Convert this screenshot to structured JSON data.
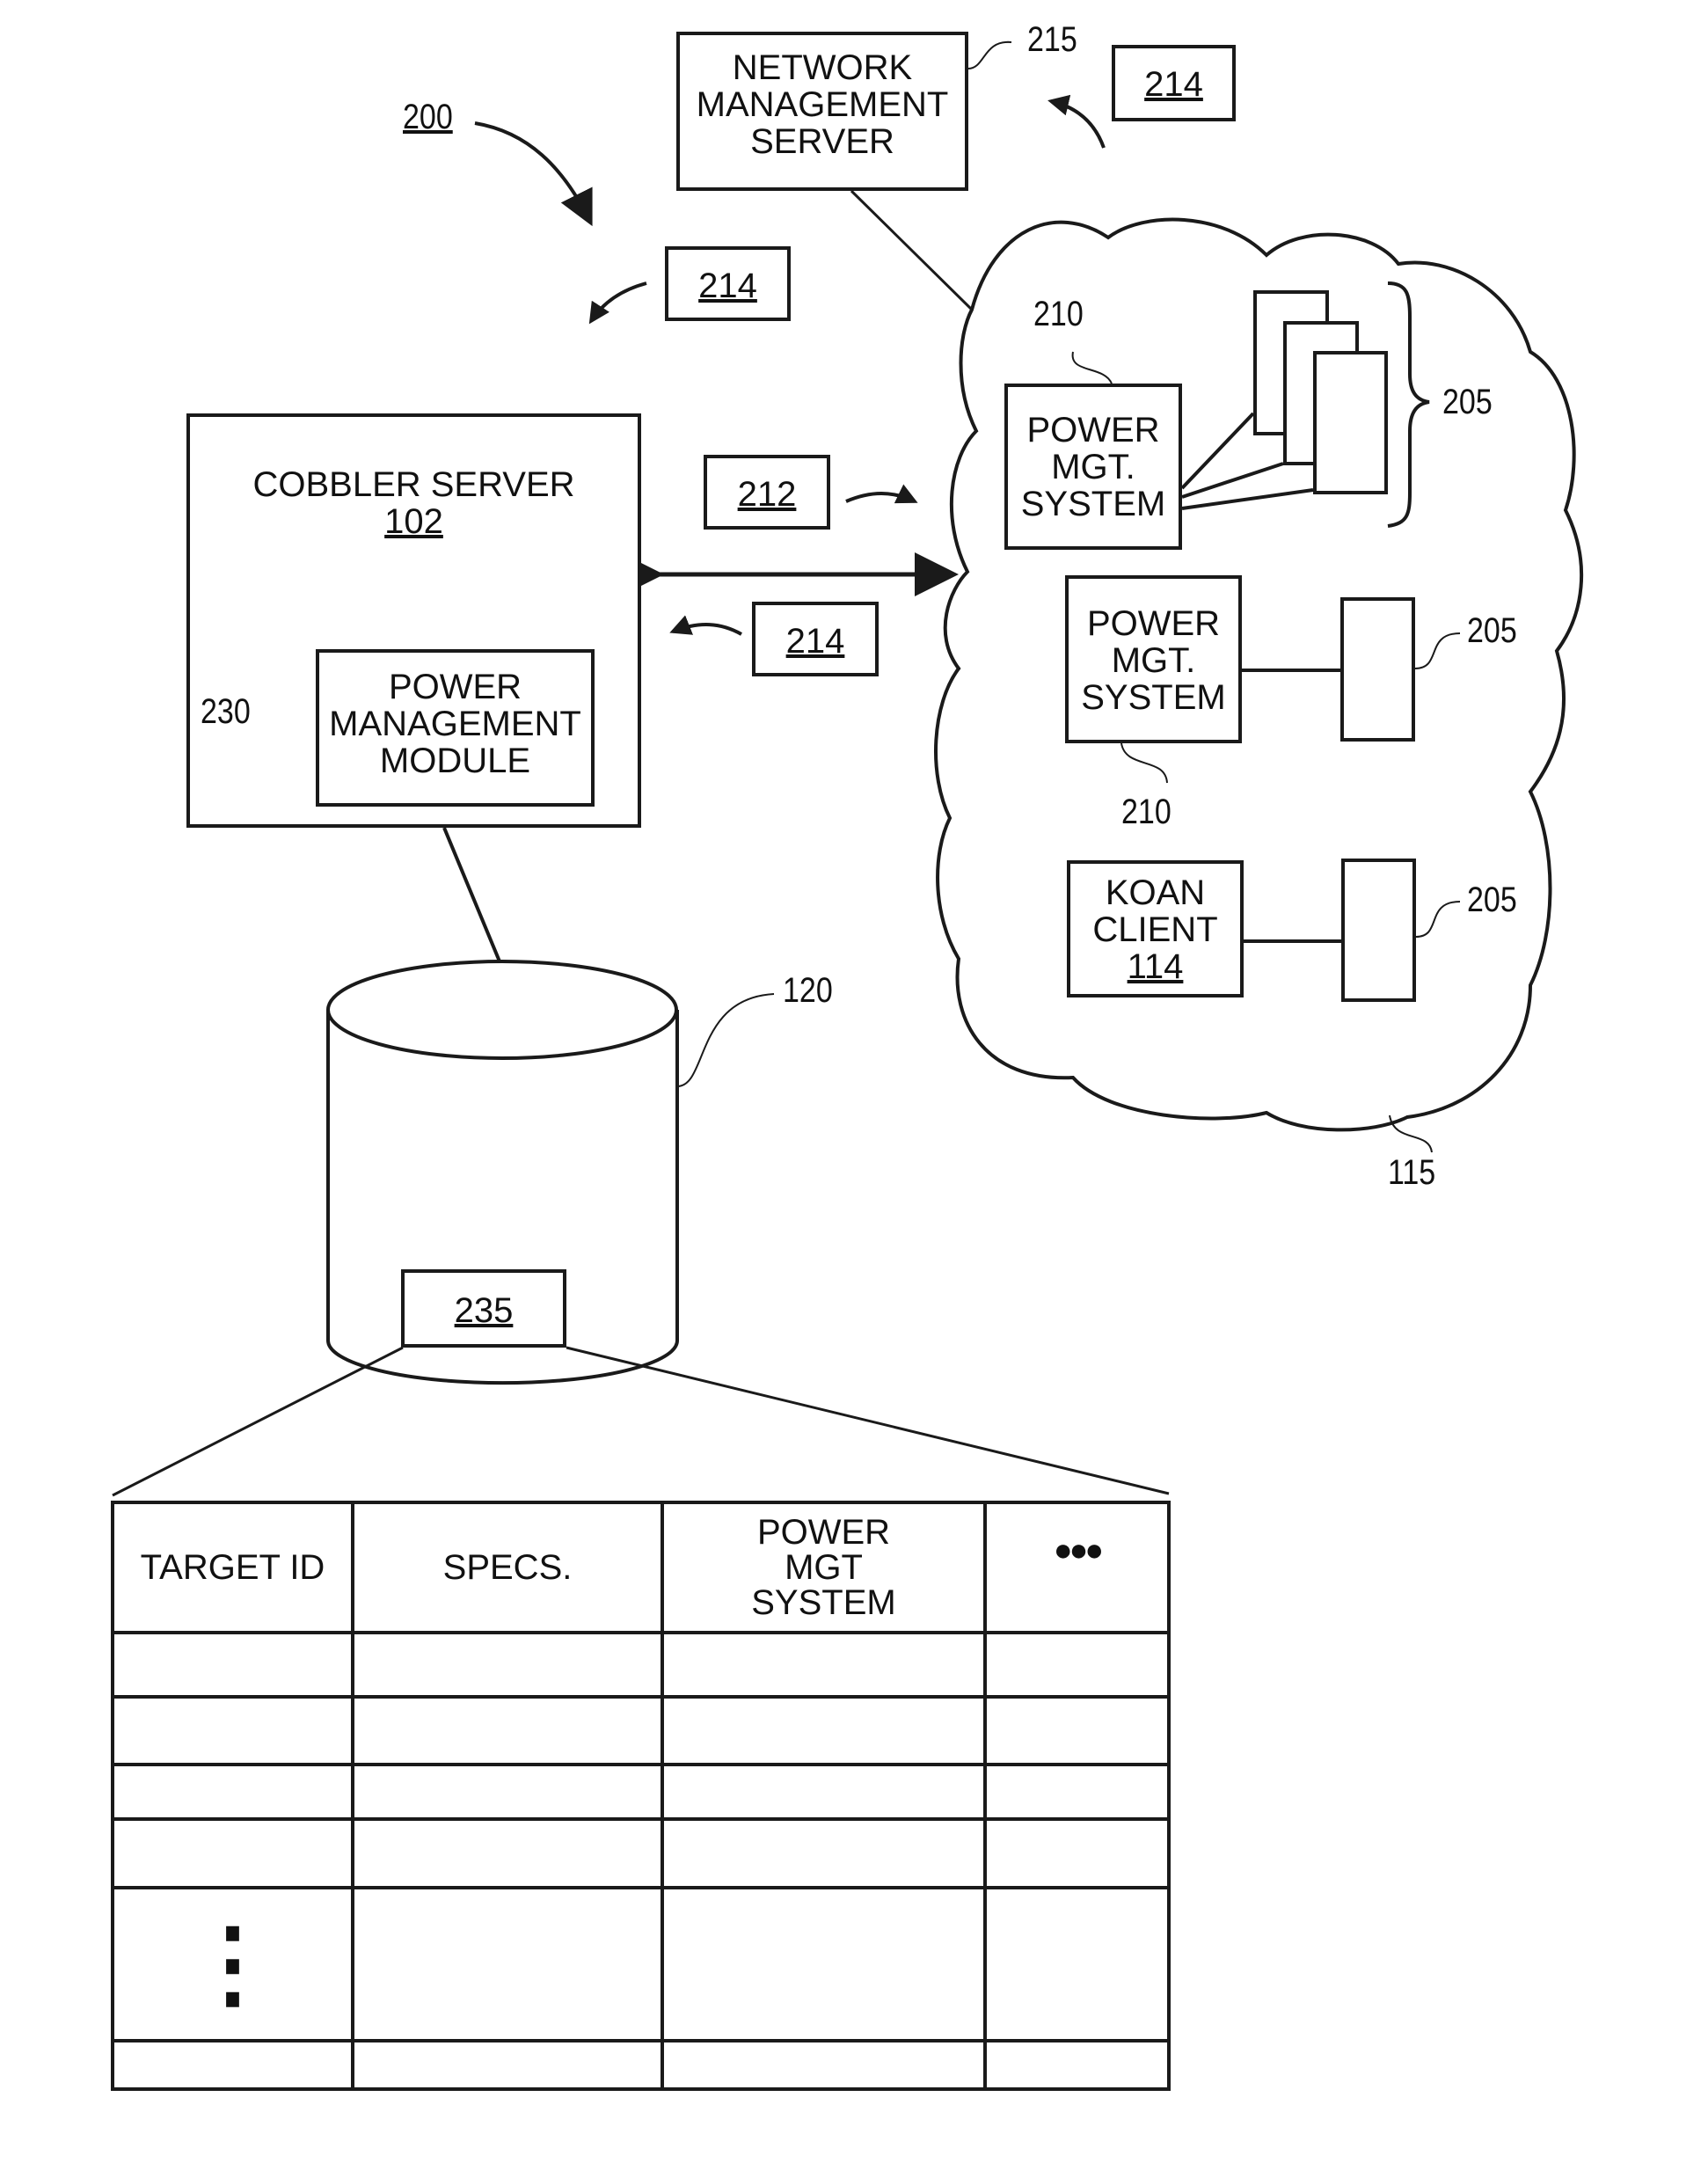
{
  "figure": {
    "ref": "200",
    "network_management_server": {
      "lines": [
        "NETWORK",
        "MANAGEMENT",
        "SERVER"
      ],
      "ref": "215"
    },
    "messages": [
      {
        "ref": "214",
        "position": "top-right"
      },
      {
        "ref": "214",
        "position": "top-center"
      },
      {
        "ref": "212",
        "position": "middle"
      },
      {
        "ref": "214",
        "position": "middle-lower"
      }
    ],
    "cobbler_server": {
      "title": "COBBLER SERVER",
      "ref": "102"
    },
    "power_management_module": {
      "lines": [
        "POWER",
        "MANAGEMENT",
        "MODULE"
      ],
      "ref": "230"
    },
    "network": {
      "ref": "115",
      "power_mgt_systems": [
        {
          "lines": [
            "POWER",
            "MGT.",
            "SYSTEM"
          ],
          "ref": "210",
          "targets_ref": "205"
        },
        {
          "lines": [
            "POWER",
            "MGT.",
            "SYSTEM"
          ],
          "ref": "210",
          "targets_ref": "205"
        }
      ],
      "koan_client": {
        "lines": [
          "KOAN",
          "CLIENT"
        ],
        "ref": "114",
        "target_ref": "205"
      }
    },
    "database": {
      "ref": "120",
      "record_ref": "235"
    },
    "table": {
      "headers": [
        "TARGET ID",
        "SPECS.",
        "POWER MGT SYSTEM",
        "●●●"
      ],
      "header_lines_col3": [
        "POWER",
        "MGT",
        "SYSTEM"
      ],
      "ellipsis_vertical": "⋮",
      "rows": [
        [
          "",
          "",
          "",
          ""
        ],
        [
          "",
          "",
          "",
          ""
        ],
        [
          "",
          "",
          "",
          ""
        ],
        [
          "",
          "",
          "",
          ""
        ],
        [
          "⋮",
          "",
          "",
          ""
        ],
        [
          "",
          "",
          "",
          ""
        ]
      ]
    }
  }
}
